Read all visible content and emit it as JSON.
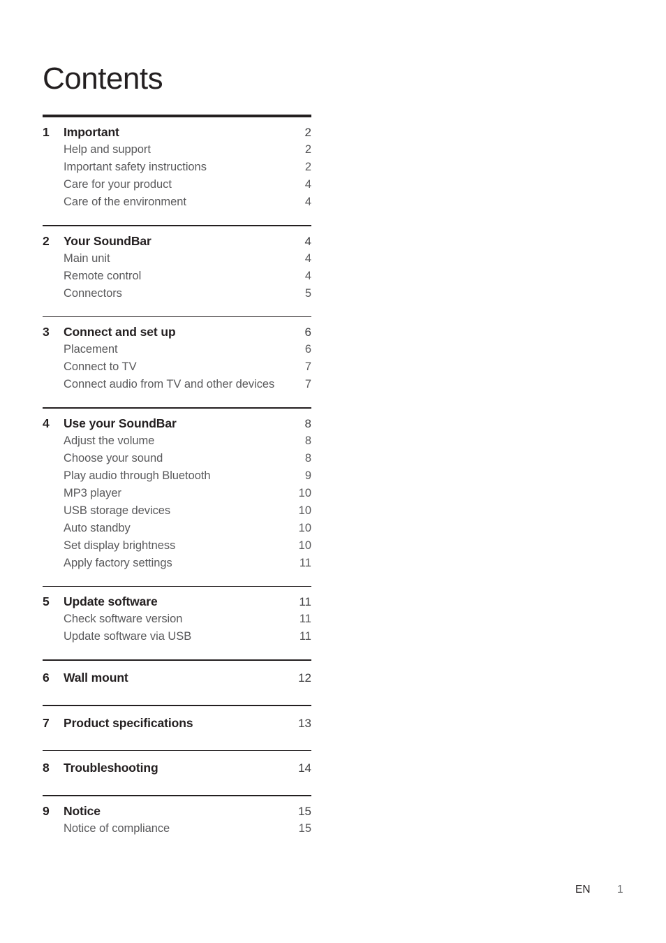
{
  "document": {
    "title": "Contents"
  },
  "toc": {
    "sections": [
      {
        "number": "1",
        "title": "Important",
        "page": "2",
        "rule": "thick",
        "items": [
          {
            "label": "Help and support",
            "page": "2"
          },
          {
            "label": "Important safety instructions",
            "page": "2"
          },
          {
            "label": "Care for your product",
            "page": "4"
          },
          {
            "label": "Care of the environment",
            "page": "4"
          }
        ]
      },
      {
        "number": "2",
        "title": "Your SoundBar",
        "page": "4",
        "rule": "thin",
        "items": [
          {
            "label": "Main unit",
            "page": "4"
          },
          {
            "label": "Remote control",
            "page": "4"
          },
          {
            "label": "Connectors",
            "page": "5"
          }
        ]
      },
      {
        "number": "3",
        "title": "Connect and set up",
        "page": "6",
        "rule": "thin",
        "items": [
          {
            "label": "Placement",
            "page": "6"
          },
          {
            "label": "Connect to TV",
            "page": "7"
          },
          {
            "label": "Connect audio from TV and other devices",
            "page": "7"
          }
        ]
      },
      {
        "number": "4",
        "title": "Use your SoundBar",
        "page": "8",
        "rule": "thin",
        "items": [
          {
            "label": "Adjust the volume",
            "page": "8"
          },
          {
            "label": "Choose your sound",
            "page": "8"
          },
          {
            "label": "Play audio through Bluetooth",
            "page": "9"
          },
          {
            "label": "MP3 player",
            "page": "10"
          },
          {
            "label": "USB storage devices",
            "page": "10"
          },
          {
            "label": "Auto standby",
            "page": "10"
          },
          {
            "label": "Set display brightness",
            "page": "10"
          },
          {
            "label": "Apply factory settings",
            "page": "11"
          }
        ]
      },
      {
        "number": "5",
        "title": "Update software",
        "page": "11",
        "rule": "thin",
        "items": [
          {
            "label": "Check software version",
            "page": "11"
          },
          {
            "label": "Update software via USB",
            "page": "11"
          }
        ]
      },
      {
        "number": "6",
        "title": "Wall mount",
        "page": "12",
        "rule": "thin",
        "items": []
      },
      {
        "number": "7",
        "title": "Product specifications",
        "page": "13",
        "rule": "thin",
        "items": []
      },
      {
        "number": "8",
        "title": "Troubleshooting",
        "page": "14",
        "rule": "thin",
        "items": []
      },
      {
        "number": "9",
        "title": "Notice",
        "page": "15",
        "rule": "thin",
        "items": [
          {
            "label": "Notice of compliance",
            "page": "15"
          }
        ]
      }
    ]
  },
  "footer": {
    "language": "EN",
    "page_number": "1"
  },
  "colors": {
    "text_dark": "#231f20",
    "text_gray": "#59595b",
    "rule": "#231f20",
    "background": "#ffffff"
  }
}
